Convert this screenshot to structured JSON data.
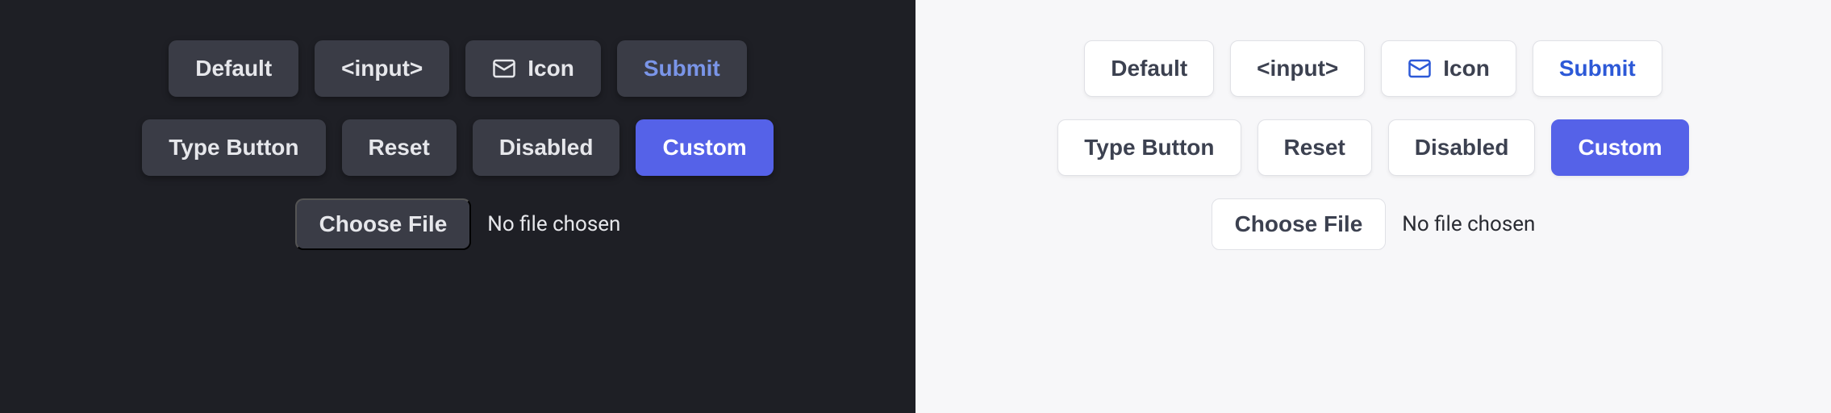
{
  "buttons": {
    "default": "Default",
    "input": "<input>",
    "icon": "Icon",
    "submit": "Submit",
    "type_button": "Type Button",
    "reset": "Reset",
    "disabled": "Disabled",
    "custom": "Custom",
    "choose_file": "Choose File",
    "file_status": "No file chosen"
  },
  "colors": {
    "dark_bg": "#1e1f25",
    "dark_btn": "#3a3c46",
    "light_bg": "#f7f7f9",
    "light_btn": "#ffffff",
    "accent": "#5562e8",
    "submit_dark": "#7a95e8",
    "submit_light": "#2d59d7"
  }
}
